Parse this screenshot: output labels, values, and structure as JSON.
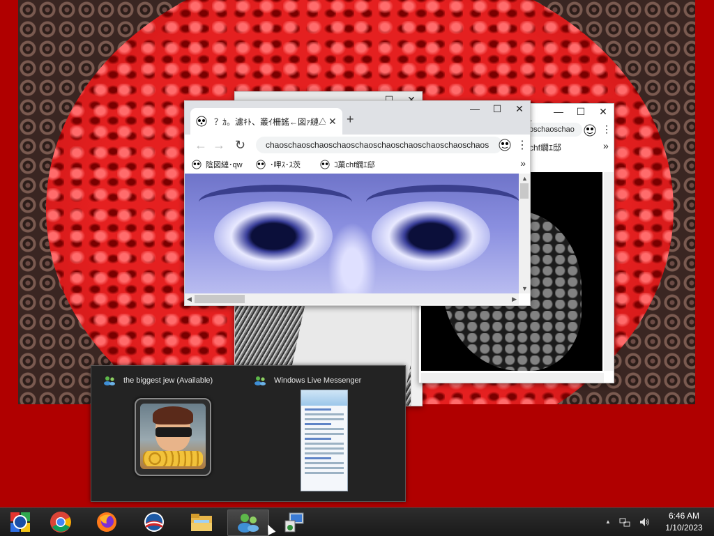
{
  "front_window": {
    "tab_title": "？ｶ。濾ｷﾄ、叢ｲ柵謠←図ｧ縺△",
    "new_tab_label": "+",
    "address": "chaoschaoschaoschaoschaoschaoschaoschaoschaoschaos",
    "bookmarks": [
      "陰図縺･qw",
      "･呷ｽ･ｽ茨",
      "ｺ菓chf繝ｴ邸"
    ],
    "overflow": "»"
  },
  "back_window_right": {
    "address": "oschaoschao",
    "bookmark": "chf繝ｴ邸",
    "overflow": "»"
  },
  "window_controls": {
    "minimize": "—",
    "maximize": "☐",
    "close": "✕"
  },
  "popup": {
    "item1_title": "the biggest jew (Available)",
    "item2_title": "Windows Live Messenger"
  },
  "taskbar": {
    "apps": [
      "start-orb-icon",
      "chrome-icon",
      "firefox-icon",
      "obama-logo-icon",
      "file-explorer-icon",
      "messenger-icon",
      "computer-icon"
    ],
    "clock_time": "6:46 AM",
    "clock_date": "1/10/2023",
    "tray_chevron": "▲"
  },
  "colors": {
    "desktop_bg": "#b00000",
    "taskbar": "#1a1a1a",
    "popup_bg": "#232323"
  }
}
